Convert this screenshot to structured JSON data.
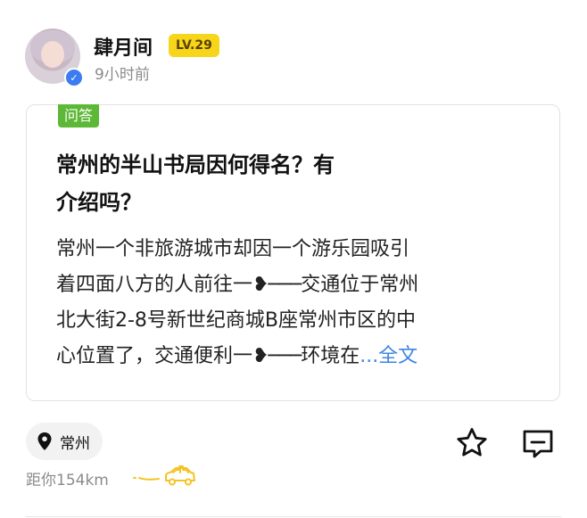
{
  "post": {
    "username": "肆月间",
    "level": "LV.29",
    "time": "9小时前",
    "tag": "问答",
    "title_lines": [
      "常州的半山书局因何得名？有",
      "介绍吗？"
    ],
    "excerpt_lines": [
      {
        "text": "常州一个非旅游城市却因一个游乐园吸引"
      },
      {
        "text": "着四面八方的人前往一",
        "ornament": "❥───",
        "after": "交通位于常州"
      },
      {
        "text": "北大街2-8号新世纪商城B座常州市区的中"
      },
      {
        "text": "心位置了，交通便利一",
        "ornament": "❥───",
        "after": "环境在",
        "more": "...全文"
      }
    ]
  },
  "footer": {
    "location": "常州",
    "distance": "距你154km"
  },
  "icons": {
    "verified": "check-badge-icon",
    "location": "location-pin-icon",
    "car": "car-icon",
    "star": "star-icon",
    "comment": "comment-icon"
  },
  "colors": {
    "level_badge": "#f7d51b",
    "tag": "#5cb836",
    "link": "#3d86e6",
    "verified": "#3b7cf0"
  }
}
